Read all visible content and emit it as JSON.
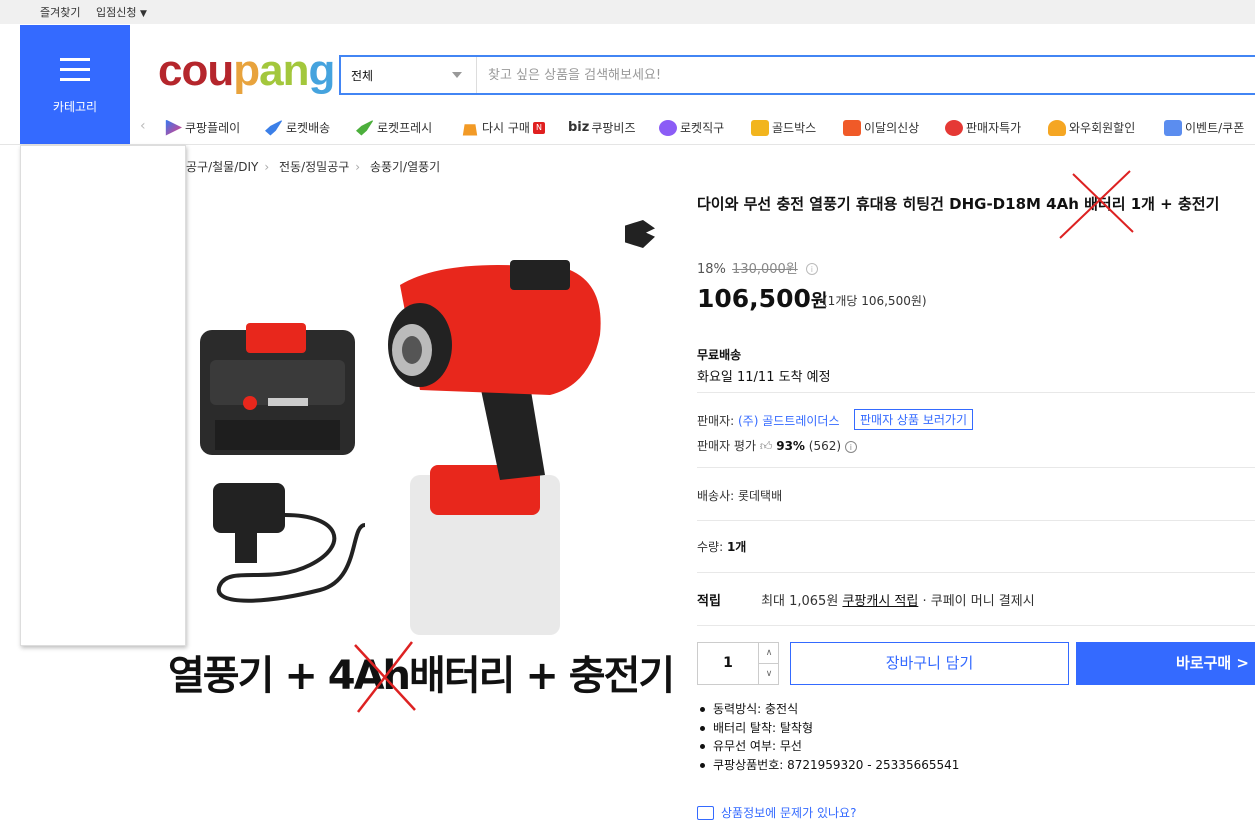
{
  "topbar": {
    "bookmark": "즐겨찾기",
    "seller_apply": "입점신청"
  },
  "header": {
    "category_label": "카테고리",
    "logo": {
      "c1": "cou",
      "c2": "p",
      "c3": "an",
      "c4": "g"
    },
    "search": {
      "select_value": "전체",
      "placeholder": "찾고 싶은 상품을 검색해보세요!"
    },
    "subnav": [
      "쿠팡플레이",
      "로켓배송",
      "로켓프레시",
      "다시 구매",
      "쿠팡비즈",
      "로켓직구",
      "골드박스",
      "이달의신상",
      "판매자특가",
      "와우회원할인",
      "이벤트/쿠폰"
    ],
    "biz_prefix": "biz"
  },
  "breadcrumb": [
    "공구/철물/DIY",
    "전동/정밀공구",
    "송풍기/열풍기"
  ],
  "product": {
    "title": "다이와 무선 충전 열풍기 휴대용 히팅건 DHG-D18M 4Ah 배터리 1개 + 충전기",
    "discount_rate": "18%",
    "original_price": "130,000원",
    "price": "106,500",
    "price_unit": "원",
    "unit_price": "(1개당 106,500원)",
    "image_caption": "열풍기 + 4Ah배터리 + 충전기",
    "shipping_label": "무료배송",
    "shipping_date": "화요일 11/11 도착 예정",
    "seller_prefix": "판매자: ",
    "seller_name": "(주) 골드트레이더스",
    "seller_link": "판매자 상품 보러가기",
    "rating_prefix": "판매자 평가",
    "rating_pct": "93%",
    "rating_count": "(562)",
    "carrier": "배송사:  롯데택배",
    "qty_prefix": "수량: ",
    "qty_value": "1개",
    "cash_label": "적립",
    "cash_text1": "최대 1,065원",
    "cash_link": "쿠팡캐시 적립",
    "cash_text2": " · 쿠페이 머니 결제시",
    "quantity": "1",
    "btn_cart": "장바구니 담기",
    "btn_buy": "바로구매 >",
    "specs": [
      "동력방식: 충전식",
      "배터리 탈착: 탈착형",
      "유무선 여부: 무선",
      "쿠팡상품번호: 8721959320 - 25335665541"
    ],
    "report": "상품정보에 문제가 있나요?"
  },
  "colors": {
    "accent": "#346aff",
    "header_blue": "#346aff",
    "battery_red": "#e8271c",
    "mark_red": "#d22"
  }
}
